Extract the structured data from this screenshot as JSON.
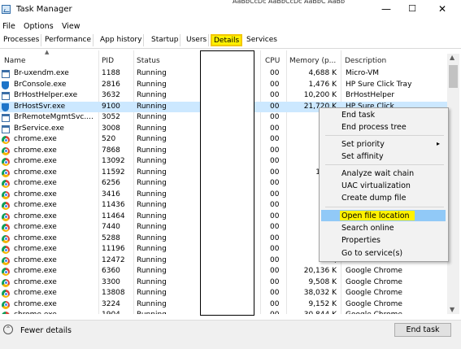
{
  "window": {
    "title": "Task Manager",
    "background_text": "AaBbCcDc  AaBbCcDc  AaBbC  AaBb",
    "minimize_icon": "minimize-icon",
    "maximize_icon": "maximize-icon",
    "close_icon": "close-icon"
  },
  "menu": {
    "file": "File",
    "options": "Options",
    "view": "View"
  },
  "tabs": {
    "processes": "Processes",
    "performance": "Performance",
    "app_history": "App history",
    "startup": "Startup",
    "users": "Users",
    "details": "Details",
    "services": "Services",
    "active": "Details",
    "highlight_color": "#fff200"
  },
  "columns": {
    "name": "Name",
    "pid": "PID",
    "status": "Status",
    "cpu": "CPU",
    "memory": "Memory (p...",
    "description": "Description"
  },
  "rows": [
    {
      "icon": "window-icon",
      "name": "Br-uxendm.exe",
      "pid": "1188",
      "status": "Running",
      "cpu": "00",
      "mem": "4,688 K",
      "desc": "Micro-VM"
    },
    {
      "icon": "shield-icon",
      "name": "BrConsole.exe",
      "pid": "2816",
      "status": "Running",
      "cpu": "00",
      "mem": "1,476 K",
      "desc": "HP Sure Click Tray"
    },
    {
      "icon": "window-icon",
      "name": "BrHostHelper.exe",
      "pid": "3632",
      "status": "Running",
      "cpu": "00",
      "mem": "10,200 K",
      "desc": "BrHostHelper"
    },
    {
      "icon": "shield-icon",
      "name": "BrHostSvr.exe",
      "pid": "9100",
      "status": "Running",
      "cpu": "00",
      "mem": "21,720 K",
      "desc": "HP Sure Click"
    },
    {
      "icon": "window-icon",
      "name": "BrRemoteMgmtSvc....",
      "pid": "3052",
      "status": "Running",
      "cpu": "00",
      "mem": "3,",
      "desc": ""
    },
    {
      "icon": "window-icon",
      "name": "BrService.exe",
      "pid": "3008",
      "status": "Running",
      "cpu": "00",
      "mem": "10,",
      "desc": ""
    },
    {
      "icon": "chrome-icon",
      "name": "chrome.exe",
      "pid": "520",
      "status": "Running",
      "cpu": "00",
      "mem": "73,",
      "desc": ""
    },
    {
      "icon": "chrome-icon",
      "name": "chrome.exe",
      "pid": "7868",
      "status": "Running",
      "cpu": "00",
      "mem": "1,",
      "desc": ""
    },
    {
      "icon": "chrome-icon",
      "name": "chrome.exe",
      "pid": "13092",
      "status": "Running",
      "cpu": "00",
      "mem": "1,",
      "desc": ""
    },
    {
      "icon": "chrome-icon",
      "name": "chrome.exe",
      "pid": "11592",
      "status": "Running",
      "cpu": "00",
      "mem": "124,5",
      "desc": ""
    },
    {
      "icon": "chrome-icon",
      "name": "chrome.exe",
      "pid": "6256",
      "status": "Running",
      "cpu": "00",
      "mem": "14,",
      "desc": ""
    },
    {
      "icon": "chrome-icon",
      "name": "chrome.exe",
      "pid": "3416",
      "status": "Running",
      "cpu": "00",
      "mem": "13,",
      "desc": ""
    },
    {
      "icon": "chrome-icon",
      "name": "chrome.exe",
      "pid": "11436",
      "status": "Running",
      "cpu": "00",
      "mem": "11,",
      "desc": ""
    },
    {
      "icon": "chrome-icon",
      "name": "chrome.exe",
      "pid": "11464",
      "status": "Running",
      "cpu": "00",
      "mem": "9,",
      "desc": ""
    },
    {
      "icon": "chrome-icon",
      "name": "chrome.exe",
      "pid": "7440",
      "status": "Running",
      "cpu": "00",
      "mem": "45,",
      "desc": ""
    },
    {
      "icon": "chrome-icon",
      "name": "chrome.exe",
      "pid": "5288",
      "status": "Running",
      "cpu": "00",
      "mem": "23,",
      "desc": ""
    },
    {
      "icon": "chrome-icon",
      "name": "chrome.exe",
      "pid": "11196",
      "status": "Running",
      "cpu": "00",
      "mem": "16,",
      "desc": ""
    },
    {
      "icon": "chrome-icon",
      "name": "chrome.exe",
      "pid": "12472",
      "status": "Running",
      "cpu": "00",
      "mem": "38,",
      "desc": ""
    },
    {
      "icon": "chrome-icon",
      "name": "chrome.exe",
      "pid": "6360",
      "status": "Running",
      "cpu": "00",
      "mem": "20,136 K",
      "desc": "Google Chrome"
    },
    {
      "icon": "chrome-icon",
      "name": "chrome.exe",
      "pid": "3300",
      "status": "Running",
      "cpu": "00",
      "mem": "9,508 K",
      "desc": "Google Chrome"
    },
    {
      "icon": "chrome-icon",
      "name": "chrome.exe",
      "pid": "13808",
      "status": "Running",
      "cpu": "00",
      "mem": "38,032 K",
      "desc": "Google Chrome"
    },
    {
      "icon": "chrome-icon",
      "name": "chrome.exe",
      "pid": "3224",
      "status": "Running",
      "cpu": "00",
      "mem": "9,152 K",
      "desc": "Google Chrome"
    },
    {
      "icon": "chrome-icon",
      "name": "chrome.exe",
      "pid": "1904",
      "status": "Running",
      "cpu": "00",
      "mem": "30,844 K",
      "desc": "Google Chrome"
    }
  ],
  "selected_row": "BrHostSvr.exe",
  "context_menu": {
    "end_task": "End task",
    "end_tree": "End process tree",
    "set_priority": "Set priority",
    "set_affinity": "Set affinity",
    "wait_chain": "Analyze wait chain",
    "uac": "UAC virtualization",
    "dump": "Create dump file",
    "open_location": "Open file location",
    "search_online": "Search online",
    "properties": "Properties",
    "go_to_service": "Go to service(s)"
  },
  "footer": {
    "fewer_details": "Fewer details",
    "end_task": "End task"
  }
}
